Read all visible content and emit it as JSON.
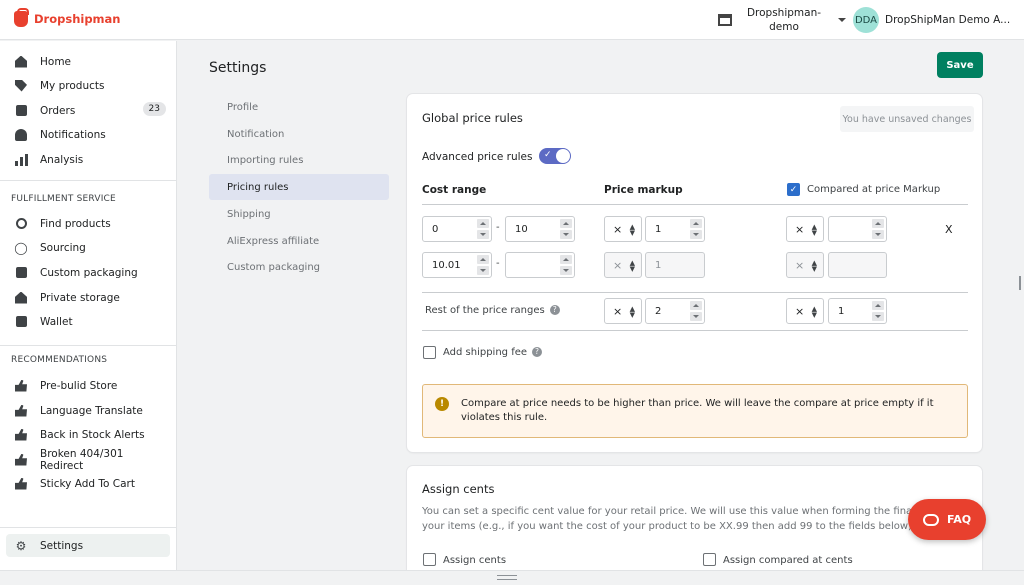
{
  "brand": {
    "name": "Dropshipman",
    "color": "#e8402e"
  },
  "store": {
    "name": "Dropshipman-demo",
    "icon": "store-icon"
  },
  "user": {
    "initials": "DDA",
    "name": "DropShipMan Demo A..."
  },
  "sidebar": {
    "main": [
      {
        "label": "Home",
        "icon": "home-icon"
      },
      {
        "label": "My products",
        "icon": "tag-icon"
      },
      {
        "label": "Orders",
        "icon": "orders-icon",
        "badge": "23"
      },
      {
        "label": "Notifications",
        "icon": "bell-icon"
      },
      {
        "label": "Analysis",
        "icon": "bar-chart-icon"
      }
    ],
    "fulfillment_title": "FULFILLMENT SERVICE",
    "fulfillment": [
      {
        "label": "Find products",
        "icon": "search-icon"
      },
      {
        "label": "Sourcing",
        "icon": "glasses-icon"
      },
      {
        "label": "Custom packaging",
        "icon": "package-icon"
      },
      {
        "label": "Private storage",
        "icon": "warehouse-icon"
      },
      {
        "label": "Wallet",
        "icon": "wallet-icon"
      }
    ],
    "recommendations_title": "RECOMMENDATIONS",
    "recommendations": [
      {
        "label": "Pre-bulid Store",
        "icon": "thumbs-up-icon"
      },
      {
        "label": "Language Translate",
        "icon": "thumbs-up-icon"
      },
      {
        "label": "Back in Stock Alerts",
        "icon": "thumbs-up-icon"
      },
      {
        "label": "Broken 404/301 Redirect",
        "icon": "thumbs-up-icon"
      },
      {
        "label": "Sticky Add To Cart",
        "icon": "thumbs-up-icon"
      }
    ],
    "settings": {
      "label": "Settings",
      "icon": "gear-icon"
    }
  },
  "page": {
    "title": "Settings",
    "save_label": "Save"
  },
  "subnav": [
    "Profile",
    "Notification",
    "Importing rules",
    "Pricing rules",
    "Shipping",
    "AliExpress affiliate",
    "Custom packaging"
  ],
  "subnav_active": "Pricing rules",
  "global": {
    "title": "Global price rules",
    "unsaved": "You have unsaved changes",
    "advanced_label": "Advanced price rules",
    "advanced_on": true,
    "col_cost": "Cost range",
    "col_markup": "Price markup",
    "col_compare": "Compared at price Markup",
    "compare_checked": true,
    "dash": "-",
    "op": "×",
    "remove": "X",
    "rows": [
      {
        "from": "0",
        "to": "10",
        "markup": "1",
        "compare": ""
      },
      {
        "from": "10.01",
        "to": "",
        "markup": "1",
        "compare": ""
      }
    ],
    "rest_label": "Rest of the price ranges",
    "rest_markup": "2",
    "rest_compare": "1",
    "shipping_fee_label": "Add shipping fee",
    "shipping_fee_checked": false,
    "warning": "Compare at price needs to be higher than price. We will leave the compare at price empty if it violates this rule."
  },
  "cents": {
    "title": "Assign cents",
    "description": "You can set a specific cent value for your retail price. We will use this value when forming the final price for your items (e.g., if you want the cost of your product to be XX.99 then add 99 to the fields below).",
    "assign_label": "Assign cents",
    "assign_compare_label": "Assign compared at cents"
  },
  "faq_label": "FAQ"
}
